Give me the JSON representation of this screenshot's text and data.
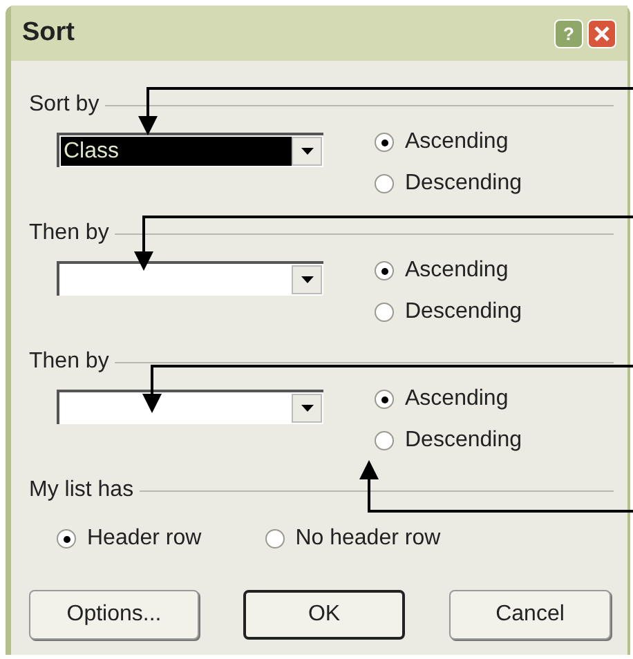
{
  "window": {
    "title": "Sort",
    "help_label": "?"
  },
  "sort_keys": [
    {
      "label": "Sort by",
      "value": "Class",
      "focused": true,
      "order": [
        {
          "label": "Ascending",
          "selected": true
        },
        {
          "label": "Descending",
          "selected": false
        }
      ]
    },
    {
      "label": "Then by",
      "focused": false,
      "order": [
        {
          "label": "Ascending",
          "selected": true
        },
        {
          "label": "Descending",
          "selected": false
        }
      ]
    },
    {
      "label": "Then by",
      "focused": false,
      "order": [
        {
          "label": "Ascending",
          "selected": true
        },
        {
          "label": "Descending",
          "selected": false
        }
      ]
    }
  ],
  "header": {
    "label": "My list has",
    "options": [
      {
        "label": "Header row",
        "selected": true
      },
      {
        "label": "No header row",
        "selected": false
      }
    ]
  },
  "buttons": [
    {
      "label": "Options...",
      "default": false
    },
    {
      "label": "OK",
      "default": true
    },
    {
      "label": "Cancel",
      "default": false
    }
  ]
}
